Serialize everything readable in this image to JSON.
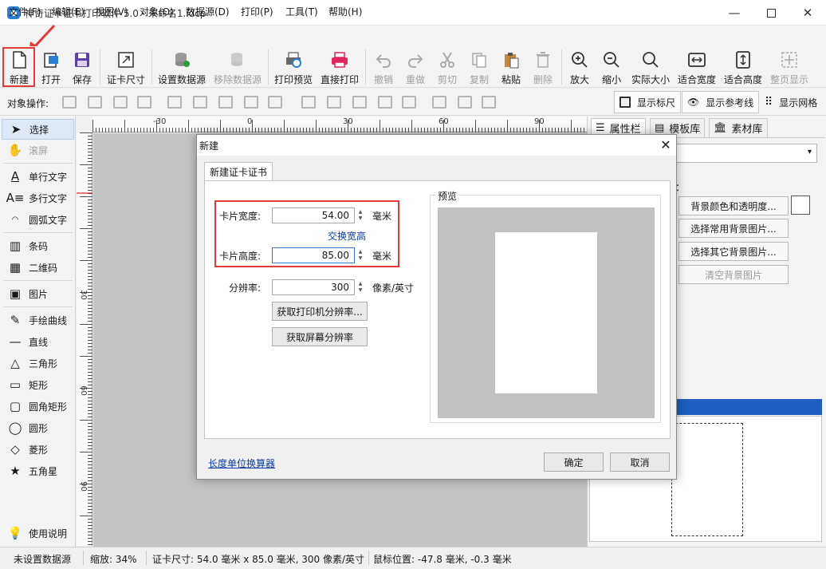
{
  "window": {
    "title": "神奇证卡证书打印软件 5.0 - 未命名1.idcp"
  },
  "menu": [
    "文件(F)",
    "编辑(E)",
    "视图(V)",
    "对象(O)",
    "数据源(D)",
    "打印(P)",
    "工具(T)",
    "帮助(H)"
  ],
  "toolbar": {
    "new": "新建",
    "open": "打开",
    "save": "保存",
    "card_size": "证卡尺寸",
    "set_datasource": "设置数据源",
    "remove_datasource": "移除数据源",
    "print_preview": "打印预览",
    "direct_print": "直接打印",
    "undo": "撤销",
    "redo": "重做",
    "cut": "剪切",
    "copy": "复制",
    "paste": "粘贴",
    "delete": "删除",
    "zoom_in": "放大",
    "zoom_out": "缩小",
    "actual_size": "实际大小",
    "fit_width": "适合宽度",
    "fit_height": "适合高度",
    "full_page": "整页显示"
  },
  "ops": {
    "label": "对象操作:",
    "show_ruler": "显示标尺",
    "show_guides": "显示参考线",
    "show_grid": "显示网格"
  },
  "tools": {
    "select": "选择",
    "scroll": "滚屏",
    "single_text": "单行文字",
    "multi_text": "多行文字",
    "arc_text": "圆弧文字",
    "barcode": "条码",
    "qrcode": "二维码",
    "image": "图片",
    "freehand": "手绘曲线",
    "line": "直线",
    "triangle": "三角形",
    "rect": "矩形",
    "rounded_rect": "圆角矩形",
    "ellipse": "圆形",
    "diamond": "菱形",
    "star": "五角星",
    "help": "使用说明"
  },
  "ruler": {
    "h": [
      "-30",
      "0",
      "30",
      "60",
      "90"
    ],
    "v": [
      "30",
      "60",
      "90"
    ]
  },
  "right": {
    "tab_props": "属性栏",
    "tab_templates": "模板库",
    "tab_assets": "素材库",
    "bg_label": "：",
    "bg_color": "背景颜色和透明度...",
    "bg_common": "选择常用背景图片...",
    "bg_other": "选择其它背景图片...",
    "bg_clear": "清空背景图片"
  },
  "status": {
    "datasource": "未设置数据源",
    "zoom": "缩放: 34%",
    "card_size": "证卡尺寸: 54.0 毫米 x 85.0 毫米, 300 像素/英寸",
    "mouse": "鼠标位置: -47.8 毫米, -0.3 毫米"
  },
  "dialog": {
    "title": "新建",
    "tab": "新建证卡证书",
    "width_label": "卡片宽度:",
    "width_value": "54.00",
    "width_unit": "毫米",
    "swap": "交换宽高",
    "height_label": "卡片高度:",
    "height_value": "85.00",
    "height_unit": "毫米",
    "dpi_label": "分辨率:",
    "dpi_value": "300",
    "dpi_unit": "像素/英寸",
    "get_printer_dpi": "获取打印机分辨率...",
    "get_screen_dpi": "获取屏幕分辨率",
    "preview": "预览",
    "converter": "长度单位换算器",
    "ok": "确定",
    "cancel": "取消"
  },
  "colors": {
    "accent": "#2a7fd4",
    "highlight": "#e53935",
    "selection_bar": "#1e5fbf"
  }
}
